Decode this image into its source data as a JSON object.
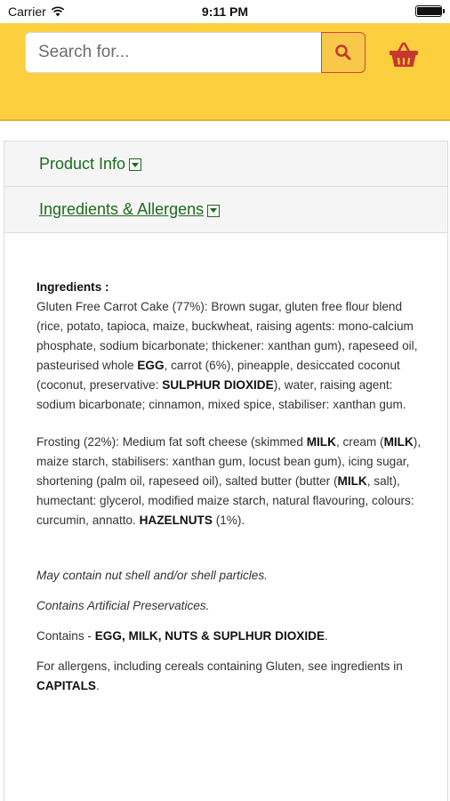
{
  "status_bar": {
    "carrier": "Carrier",
    "time": "9:11 PM",
    "battery_level": 0.95
  },
  "search": {
    "placeholder": "Search for...",
    "value": ""
  },
  "icons": {
    "search": "search-icon",
    "basket": "basket-icon",
    "wifi": "wifi-icon",
    "caret": "caret-down-icon"
  },
  "colors": {
    "header": "#fbcf3e",
    "accent_green": "#1f6b1f",
    "basket_red": "#c8372d"
  },
  "accordion": {
    "product_info": "Product Info",
    "ingredients_allergens": "Ingredients & Allergens"
  },
  "ingredients": {
    "heading": "Ingredients :",
    "cake": {
      "t1": "Gluten Free Carrot Cake (77%): Brown sugar, gluten free flour blend (rice, potato, tapioca, maize, buckwheat, raising agents: mono-calcium phosphate, sodium bicarbonate; thickener: xanthan gum), rapeseed oil, pasteurised whole ",
      "b1": "EGG",
      "t2": ", carrot (6%), pineapple, desiccated coconut (coconut, preservative: ",
      "b2": "SULPHUR DIOXIDE",
      "t3": "), water, raising agent: sodium bicarbonate; cinnamon, mixed spice, stabiliser: xanthan gum."
    },
    "frosting": {
      "t1": "Frosting (22%): Medium fat soft cheese (skimmed ",
      "b1": "MILK",
      "t2": ", cream (",
      "b2": "MILK",
      "t3": "), maize starch, stabilisers: xanthan gum, locust bean gum), icing sugar, shortening (palm oil, rapeseed oil), salted butter (butter (",
      "b3": "MILK",
      "t4": ", salt), humectant: glycerol, modified maize starch, natural flavouring, colours: curcumin, annatto. ",
      "b4": "HAZELNUTS",
      "t5": " (1%)."
    },
    "may_contain": "May contain nut shell and/or shell particles.",
    "preservatives": "Contains Artificial Preservatices.",
    "contains": {
      "t1": "Contains - ",
      "b1": "EGG, MILK, NUTS & SUPLHUR DIOXIDE",
      "t2": "."
    },
    "allergens_note": {
      "t1": "For allergens, including cereals containing Gluten, see ingredients in ",
      "b1": "CAPITALS",
      "t2": "."
    }
  }
}
